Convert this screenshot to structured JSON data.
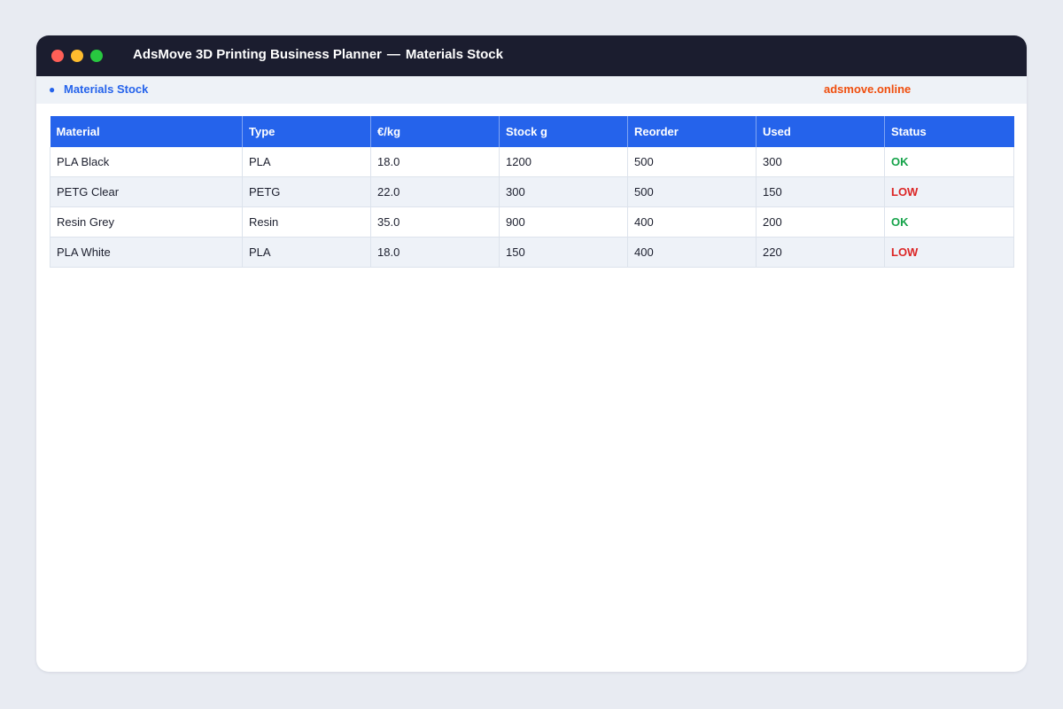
{
  "window": {
    "app_title": "AdsMove 3D Printing Business Planner",
    "separator": "—",
    "page_title": "Materials Stock"
  },
  "subbar": {
    "bullet": "●",
    "section_label": "Materials Stock",
    "brand": "adsmove.online"
  },
  "table": {
    "headers": [
      "Material",
      "Type",
      "€/kg",
      "Stock g",
      "Reorder",
      "Used",
      "Status"
    ],
    "rows": [
      {
        "material": "PLA Black",
        "type": "PLA",
        "price": "18.0",
        "stock": "1200",
        "reorder": "500",
        "used": "300",
        "status": "OK"
      },
      {
        "material": "PETG Clear",
        "type": "PETG",
        "price": "22.0",
        "stock": "300",
        "reorder": "500",
        "used": "150",
        "status": "LOW"
      },
      {
        "material": "Resin Grey",
        "type": "Resin",
        "price": "35.0",
        "stock": "900",
        "reorder": "400",
        "used": "200",
        "status": "OK"
      },
      {
        "material": "PLA White",
        "type": "PLA",
        "price": "18.0",
        "stock": "150",
        "reorder": "400",
        "used": "220",
        "status": "LOW"
      }
    ]
  },
  "colors": {
    "titlebar": "#1b1d2f",
    "accent": "#2563eb",
    "brand": "#f04e0d",
    "status_ok": "#16a34a",
    "status_low": "#dc2626"
  }
}
